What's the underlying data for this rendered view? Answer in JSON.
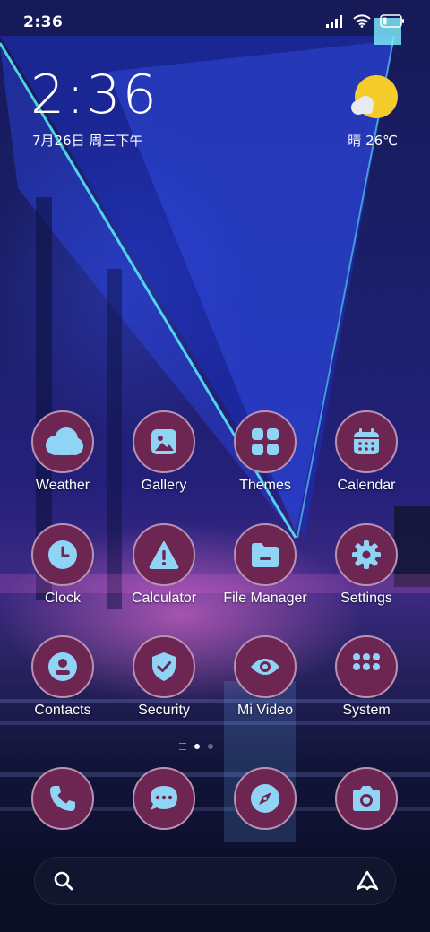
{
  "statusbar": {
    "time": "2:36"
  },
  "lockclock": {
    "time": "2:36",
    "date": "7月26日 周三下午"
  },
  "weather": {
    "temp": "晴 26℃"
  },
  "apps": [
    {
      "label": "Weather",
      "icon": "cloud-icon"
    },
    {
      "label": "Gallery",
      "icon": "image-icon"
    },
    {
      "label": "Themes",
      "icon": "grid-icon"
    },
    {
      "label": "Calendar",
      "icon": "calendar-icon"
    },
    {
      "label": "Clock",
      "icon": "clock-icon"
    },
    {
      "label": "Calculator",
      "icon": "warning-icon"
    },
    {
      "label": "File Manager",
      "icon": "folder-icon"
    },
    {
      "label": "Settings",
      "icon": "gear-icon"
    },
    {
      "label": "Contacts",
      "icon": "person-icon"
    },
    {
      "label": "Security",
      "icon": "shield-check-icon"
    },
    {
      "label": "Mi Video",
      "icon": "eye-icon"
    },
    {
      "label": "System",
      "icon": "folder-grid-icon"
    }
  ],
  "dock": [
    {
      "icon": "phone-icon"
    },
    {
      "icon": "message-icon"
    },
    {
      "icon": "compass-icon"
    },
    {
      "icon": "camera-icon"
    }
  ],
  "colors": {
    "icon_bg": "#6d2552",
    "icon_border": "#b892b3",
    "glyph": "#8fd4f5"
  }
}
